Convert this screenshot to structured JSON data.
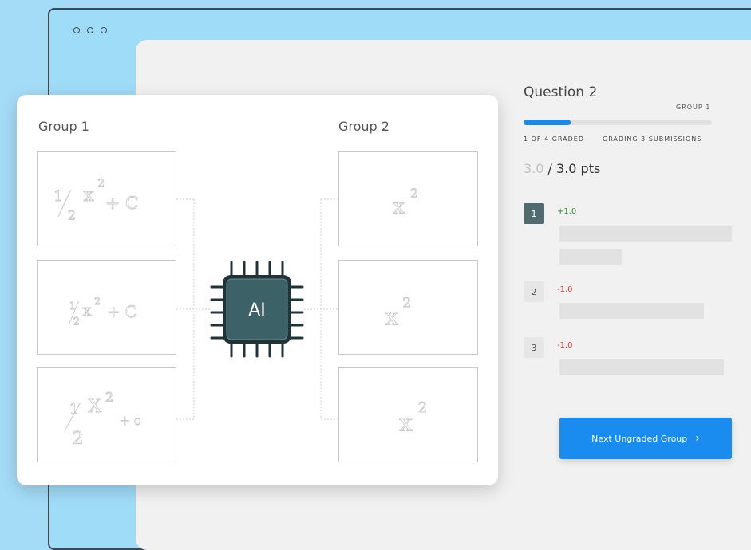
{
  "window": {
    "dots": [
      "dot",
      "dot",
      "dot"
    ]
  },
  "grader": {
    "question_title": "Question 2",
    "group_label": "GROUP 1",
    "progress": {
      "graded": 1,
      "total": 4,
      "fraction": 0.25
    },
    "graded_text": "1 OF 4 GRADED",
    "submissions_text": "GRADING 3 SUBMISSIONS",
    "score": "3.0",
    "max_points": "/ 3.0 pts",
    "submissions": [
      {
        "number": "1",
        "delta": "+1.0",
        "type": "positive",
        "active": true
      },
      {
        "number": "2",
        "delta": "-1.0",
        "type": "negative",
        "active": false
      },
      {
        "number": "3",
        "delta": "-1.0",
        "type": "negative",
        "active": false
      }
    ],
    "next_button_label": "Next Ungraded Group",
    "next_button_icon": "chevron-right-icon"
  },
  "grouping_card": {
    "group1_title": "Group 1",
    "group2_title": "Group 2",
    "ai_label": "AI",
    "group1_answers": [
      {
        "main": "½x² + C",
        "a": "1",
        "b": "2",
        "c": "x",
        "d": "2",
        "e": "+ C"
      },
      {
        "main": "½x² + C",
        "a": "1",
        "b": "2",
        "c": "x",
        "d": "2",
        "e": "+ C"
      },
      {
        "main": "½x² + c",
        "a": "1",
        "b": "2",
        "c": "X",
        "d": "2",
        "e": "+ c"
      }
    ],
    "group2_answers": [
      {
        "base": "x",
        "exp": "2"
      },
      {
        "base": "x",
        "exp": "2"
      },
      {
        "base": "x",
        "exp": "2"
      }
    ],
    "colors": {
      "chip": "#3c6268",
      "chip_outline": "#1f3338",
      "accent": "#1a8cf0"
    }
  }
}
